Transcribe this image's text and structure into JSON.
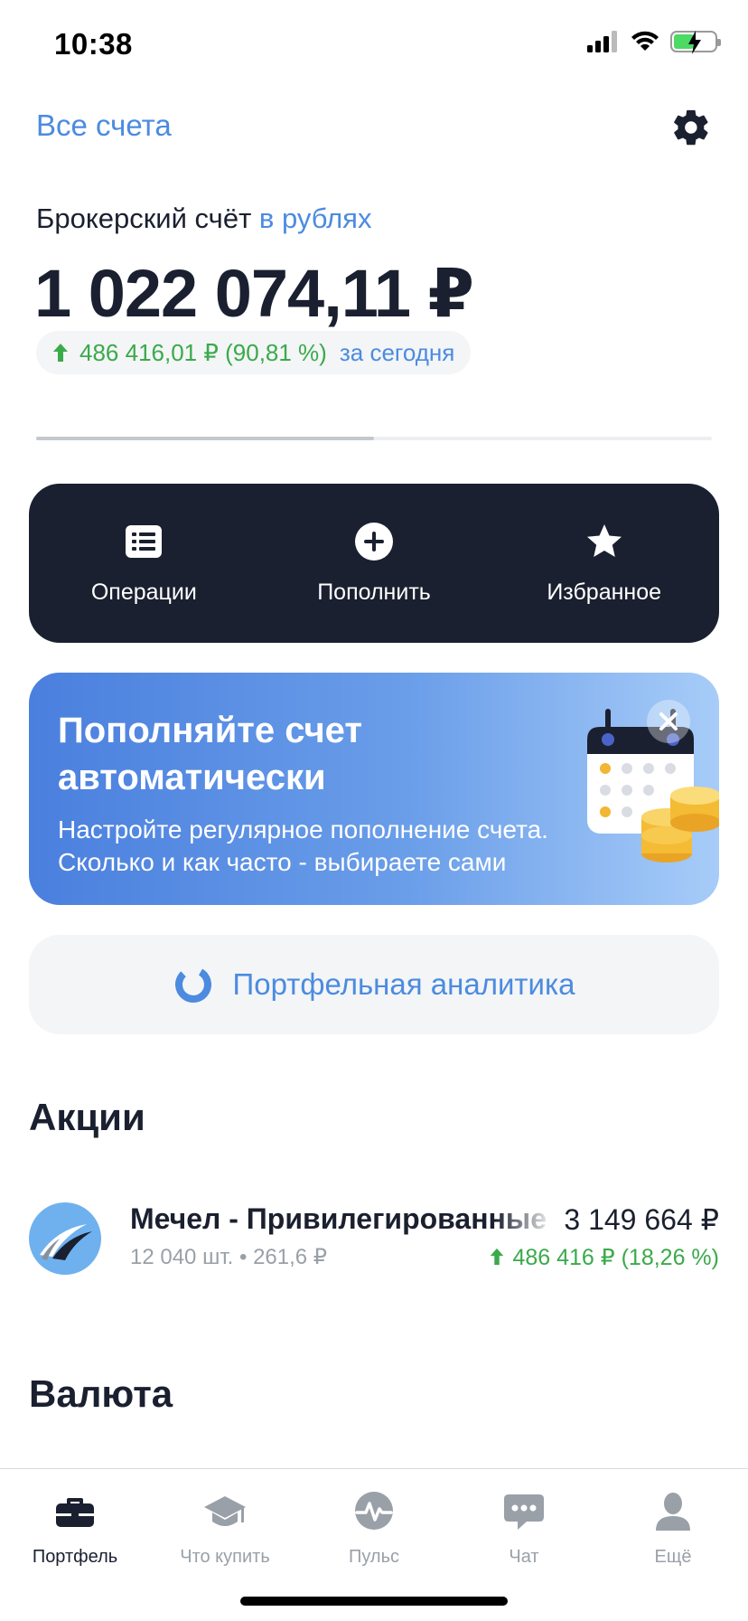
{
  "status_bar": {
    "time": "10:38"
  },
  "header": {
    "all_accounts": "Все счета"
  },
  "account": {
    "title": "Брокерский счёт",
    "currency_link": "в рублях",
    "balance": "1 022 074,11 ₽",
    "change": "486 416,01 ₽ (90,81 %)",
    "change_period": "за сегодня",
    "carousel_progress": 0.5
  },
  "actions": [
    {
      "label": "Операции",
      "icon": "list-icon"
    },
    {
      "label": "Пополнить",
      "icon": "plus-circle-icon"
    },
    {
      "label": "Избранное",
      "icon": "star-icon"
    }
  ],
  "promo": {
    "title": "Пополняйте счет автоматически",
    "text": "Настройте регулярное пополнение счета. Сколько и как часто - выбираете сами"
  },
  "analytics": {
    "label": "Портфельная аналитика"
  },
  "sections": {
    "stocks_title": "Акции",
    "currency_title": "Валюта"
  },
  "stocks": [
    {
      "name": "Мечел - Привилегированные",
      "sub": "12 040 шт. • 261,6 ₽",
      "value": "3 149 664 ₽",
      "change": "486 416 ₽ (18,26 %)"
    }
  ],
  "tabs": [
    {
      "label": "Портфель",
      "icon": "briefcase-icon",
      "active": true
    },
    {
      "label": "Что купить",
      "icon": "graduation-cap-icon",
      "active": false
    },
    {
      "label": "Пульс",
      "icon": "pulse-icon",
      "active": false
    },
    {
      "label": "Чат",
      "icon": "chat-icon",
      "active": false
    },
    {
      "label": "Ещё",
      "icon": "person-icon",
      "active": false
    }
  ],
  "colors": {
    "accent": "#4c8be0",
    "positive": "#3aaa4a",
    "dark_card": "#1a2030"
  }
}
